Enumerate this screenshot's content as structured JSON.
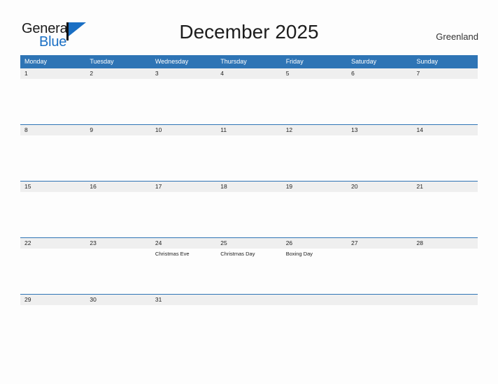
{
  "header": {
    "logo": {
      "word1": "General",
      "word2": "Blue",
      "icon": "flag-triangle-icon"
    },
    "title": "December 2025",
    "region": "Greenland"
  },
  "calendar": {
    "weekdays": [
      "Monday",
      "Tuesday",
      "Wednesday",
      "Thursday",
      "Friday",
      "Saturday",
      "Sunday"
    ],
    "accent_color": "#2e74b5",
    "band_color": "#efefef",
    "weeks": [
      {
        "days": [
          {
            "num": "1",
            "events": []
          },
          {
            "num": "2",
            "events": []
          },
          {
            "num": "3",
            "events": []
          },
          {
            "num": "4",
            "events": []
          },
          {
            "num": "5",
            "events": []
          },
          {
            "num": "6",
            "events": []
          },
          {
            "num": "7",
            "events": []
          }
        ]
      },
      {
        "days": [
          {
            "num": "8",
            "events": []
          },
          {
            "num": "9",
            "events": []
          },
          {
            "num": "10",
            "events": []
          },
          {
            "num": "11",
            "events": []
          },
          {
            "num": "12",
            "events": []
          },
          {
            "num": "13",
            "events": []
          },
          {
            "num": "14",
            "events": []
          }
        ]
      },
      {
        "days": [
          {
            "num": "15",
            "events": []
          },
          {
            "num": "16",
            "events": []
          },
          {
            "num": "17",
            "events": []
          },
          {
            "num": "18",
            "events": []
          },
          {
            "num": "19",
            "events": []
          },
          {
            "num": "20",
            "events": []
          },
          {
            "num": "21",
            "events": []
          }
        ]
      },
      {
        "days": [
          {
            "num": "22",
            "events": []
          },
          {
            "num": "23",
            "events": []
          },
          {
            "num": "24",
            "events": [
              "Christmas Eve"
            ]
          },
          {
            "num": "25",
            "events": [
              "Christmas Day"
            ]
          },
          {
            "num": "26",
            "events": [
              "Boxing Day"
            ]
          },
          {
            "num": "27",
            "events": []
          },
          {
            "num": "28",
            "events": []
          }
        ]
      },
      {
        "days": [
          {
            "num": "29",
            "events": []
          },
          {
            "num": "30",
            "events": []
          },
          {
            "num": "31",
            "events": []
          },
          {
            "num": "",
            "events": []
          },
          {
            "num": "",
            "events": []
          },
          {
            "num": "",
            "events": []
          },
          {
            "num": "",
            "events": []
          }
        ]
      }
    ]
  }
}
